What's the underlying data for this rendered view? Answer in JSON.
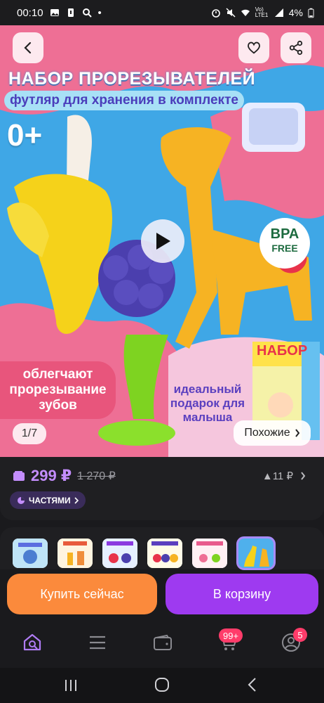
{
  "status_bar": {
    "time": "00:10",
    "battery": "4%",
    "network": "Vo) LTE1"
  },
  "hero": {
    "title": "НАБОР ПРОРЕЗЫВАТЕЛЕЙ",
    "subtitle": "футляр для хранения в комплекте",
    "age": "0+",
    "badge_line1": "BPA",
    "badge_line2": "FREE",
    "left_text": "облегчают прорезывание зубов",
    "right_text": "идеальный подарок для малыша",
    "box_text": "НАБОР",
    "counter": "1/7",
    "similar_label": "Похожие"
  },
  "price": {
    "current": "299 ₽",
    "old": "1 270 ₽",
    "rating": "11 ₽",
    "installment_label": "ЧАСТЯМИ"
  },
  "actions": {
    "buy_now": "Купить сейчас",
    "add_to_cart": "В корзину"
  },
  "tabbar": {
    "cart_badge": "99+",
    "profile_badge": "5"
  },
  "colors": {
    "accent_purple": "#9e3af0",
    "accent_orange": "#fb8a3c",
    "price_purple": "#c38dfc",
    "badge_red": "#ff3c6a"
  },
  "icons": [
    "back-icon",
    "heart-icon",
    "share-icon",
    "play-icon",
    "wallet-icon",
    "chevron-right-icon",
    "home-search-icon",
    "menu-icon",
    "card-icon",
    "cart-icon",
    "profile-icon"
  ]
}
